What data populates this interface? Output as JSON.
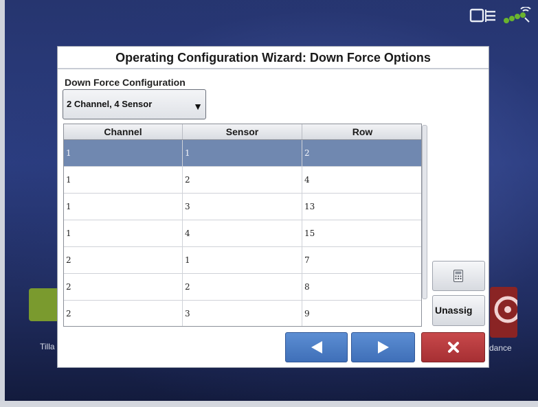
{
  "status_bar": {
    "device_icon": "display-device-icon",
    "gps_icon": "gps-signal-icon"
  },
  "background": {
    "left_tile_label": "Tilla",
    "right_tile_label": "dance"
  },
  "dialog": {
    "title": "Operating Configuration Wizard: Down Force Options",
    "config_label": "Down Force Configuration",
    "config_value": "2 Channel, 4 Sensor",
    "columns": [
      "Channel",
      "Sensor",
      "Row"
    ],
    "rows": [
      {
        "channel": "1",
        "sensor": "1",
        "row": "2",
        "selected": true
      },
      {
        "channel": "1",
        "sensor": "2",
        "row": "4"
      },
      {
        "channel": "1",
        "sensor": "3",
        "row": "13"
      },
      {
        "channel": "1",
        "sensor": "4",
        "row": "15"
      },
      {
        "channel": "2",
        "sensor": "1",
        "row": "7"
      },
      {
        "channel": "2",
        "sensor": "2",
        "row": "8"
      },
      {
        "channel": "2",
        "sensor": "3",
        "row": "9"
      },
      {
        "channel": "",
        "sensor": "",
        "row": ""
      }
    ],
    "unassign_label": "Unassig",
    "calculator_icon": "calculator-icon",
    "prev_icon": "left-arrow-icon",
    "next_icon": "right-arrow-icon",
    "cancel_icon": "close-icon"
  },
  "colors": {
    "selected_row": "#7088b0",
    "nav_blue": "#4a7cc4",
    "cancel_red": "#b33b3e"
  }
}
